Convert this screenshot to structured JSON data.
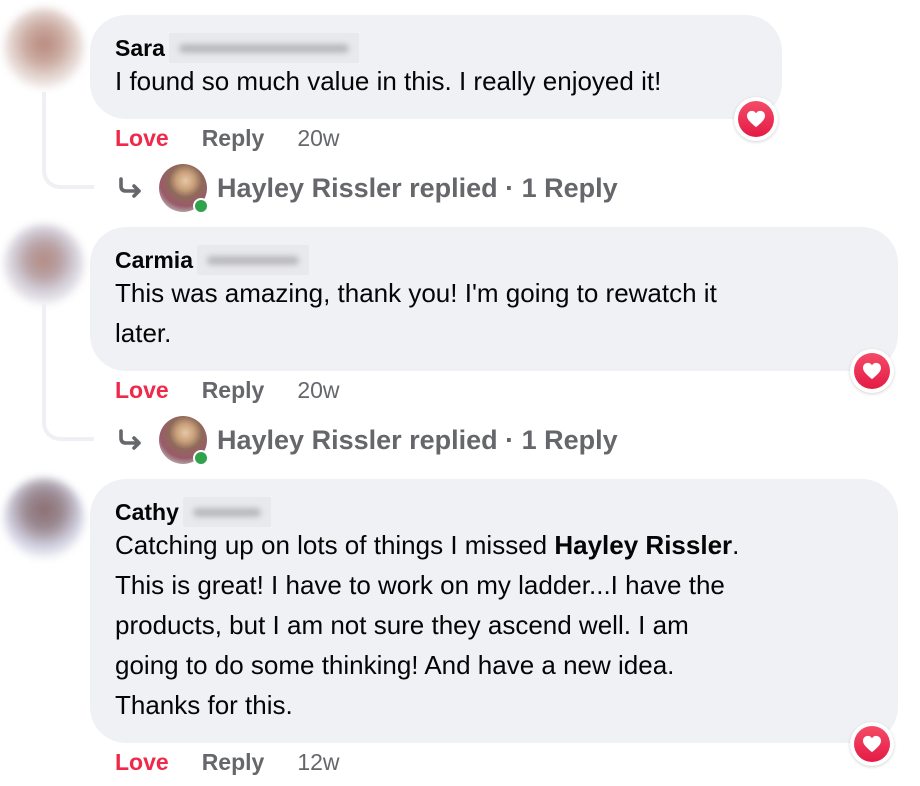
{
  "comments": [
    {
      "author": "Sara",
      "text": "I found so much value in this. I really enjoyed it!",
      "reaction": "love",
      "actions": {
        "love": "Love",
        "reply": "Reply",
        "time": "20w"
      },
      "replies": {
        "replier": "Hayley Rissler",
        "summary": "Hayley Rissler replied · 1 Reply"
      }
    },
    {
      "author": "Carmia",
      "text_lines": [
        "This was amazing, thank you! I'm going to rewatch it",
        "later."
      ],
      "reaction": "love",
      "actions": {
        "love": "Love",
        "reply": "Reply",
        "time": "20w"
      },
      "replies": {
        "replier": "Hayley Rissler",
        "summary": "Hayley Rissler replied · 1 Reply"
      }
    },
    {
      "author": "Cathy",
      "text_pre": "Catching up on lots of things I missed ",
      "mention": "Hayley Rissler",
      "text_post": ".",
      "text_lines": [
        "This is great! I have to work on my ladder...I have the",
        "products, but I am not sure they ascend well. I am",
        "going to do some thinking! And have a new idea.",
        "Thanks for this."
      ],
      "reaction": "love",
      "actions": {
        "love": "Love",
        "reply": "Reply",
        "time": "12w"
      }
    }
  ],
  "colors": {
    "bubble_bg": "#f0f1f5",
    "love_red": "#f0284a",
    "secondary_text": "#65676b",
    "online_green": "#31a24c"
  }
}
